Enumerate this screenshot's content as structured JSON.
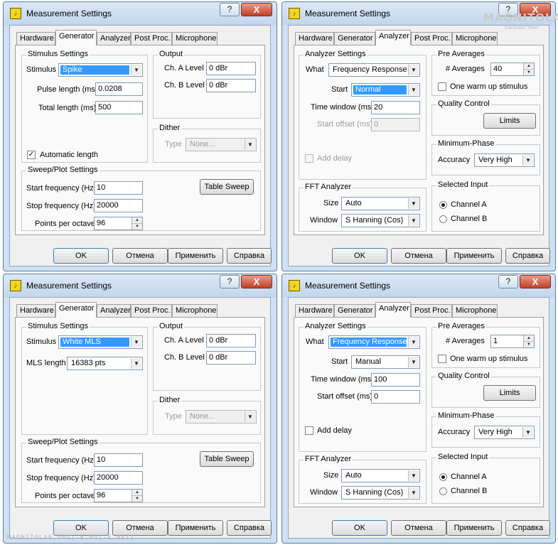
{
  "common": {
    "title": "Measurement Settings",
    "help_glyph": "?",
    "close_glyph": "X",
    "tabs": [
      "Hardware",
      "Generator",
      "Analyzer",
      "Post Proc.",
      "Microphone"
    ],
    "buttons": {
      "ok": "OK",
      "cancel": "Отмена",
      "apply": "Применить",
      "help": "Справка"
    }
  },
  "gen1": {
    "stimulus_group": "Stimulus Settings",
    "stimulus_label": "Stimulus",
    "stimulus_value": "Spike",
    "pulse_label": "Pulse length (ms)",
    "pulse_value": "0.0208",
    "total_label": "Total length (ms)",
    "total_value": "500",
    "auto_label": "Automatic length",
    "auto_mark": "✓",
    "output_group": "Output",
    "cha_label": "Ch. A Level",
    "cha_value": "0 dBr",
    "chb_label": "Ch. B Level",
    "chb_value": "0 dBr",
    "dither_group": "Dither",
    "type_label": "Type",
    "type_value": "None...",
    "sweep_group": "Sweep/Plot Settings",
    "start_label": "Start frequency (Hz)",
    "start_value": "10",
    "stop_label": "Stop frequency (Hz)",
    "stop_value": "20000",
    "ppo_label": "Points per octave",
    "ppo_value": "96",
    "table_sweep": "Table Sweep"
  },
  "gen2": {
    "stimulus_group": "Stimulus Settings",
    "stimulus_label": "Stimulus",
    "stimulus_value": "White MLS",
    "mls_label": "MLS length",
    "mls_value": "16383 pts",
    "output_group": "Output",
    "cha_label": "Ch. A Level",
    "cha_value": "0 dBr",
    "chb_label": "Ch. B Level",
    "chb_value": "0 dBr",
    "dither_group": "Dither",
    "type_label": "Type",
    "type_value": "None...",
    "sweep_group": "Sweep/Plot Settings",
    "start_label": "Start frequency (Hz)",
    "start_value": "10",
    "stop_label": "Stop frequency (Hz)",
    "stop_value": "20000",
    "ppo_label": "Points per octave",
    "ppo_value": "96",
    "table_sweep": "Table Sweep"
  },
  "ana1": {
    "analyzer_group": "Analyzer Settings",
    "what_label": "What",
    "what_value": "Frequency Response",
    "start_label": "Start",
    "start_value": "Normal",
    "window_label": "Time window (ms)",
    "window_value": "20",
    "offset_label": "Start offset (ms)",
    "offset_value": "0",
    "delay_label": "Add delay",
    "fft_group": "FFT Analyzer",
    "size_label": "Size",
    "size_value": "Auto",
    "fftwin_label": "Window",
    "fftwin_value": "S Hanning (Cos)",
    "preavg_group": "Pre Averages",
    "avg_label": "# Averages",
    "avg_value": "40",
    "warm_label": "One warm up stimulus",
    "quality_group": "Quality Control",
    "limits_label": "Limits",
    "minphase_group": "Minimum-Phase",
    "accuracy_label": "Accuracy",
    "accuracy_value": "Very High",
    "input_group": "Selected Input",
    "cha_label": "Channel A",
    "chb_label": "Channel B"
  },
  "ana2": {
    "analyzer_group": "Analyzer Settings",
    "what_label": "What",
    "what_value": "Frequency Response",
    "start_label": "Start",
    "start_value": "Manual",
    "window_label": "Time window (ms)",
    "window_value": "100",
    "offset_label": "Start offset (ms)",
    "offset_value": "0",
    "delay_label": "Add delay",
    "fft_group": "FFT Analyzer",
    "size_label": "Size",
    "size_value": "Auto",
    "fftwin_label": "Window",
    "fftwin_value": "S Hanning (Cos)",
    "preavg_group": "Pre Averages",
    "avg_label": "# Averages",
    "avg_value": "1",
    "warm_label": "One warm up stimulus",
    "quality_group": "Quality Control",
    "limits_label": "Limits",
    "minphase_group": "Minimum-Phase",
    "accuracy_label": "Accuracy",
    "accuracy_value": "Very High",
    "input_group": "Selected Input",
    "cha_label": "Channel A",
    "chb_label": "Channel B"
  },
  "watermark": {
    "brand": "MAGNITOLA",
    "team": "CarAudio Team",
    "footer": "MAGNITOLAE.ORG|-E.RU|-E.NET|"
  }
}
